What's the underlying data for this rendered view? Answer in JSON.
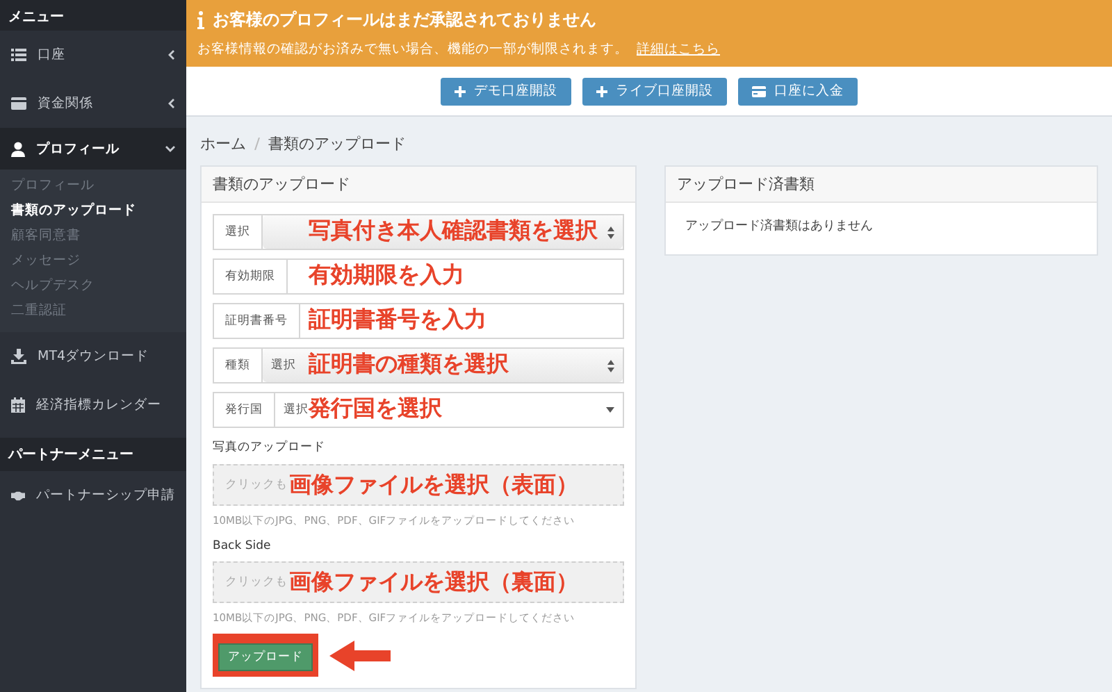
{
  "sidebar": {
    "header": "メニュー",
    "items": [
      {
        "kind": "group",
        "label": "口座",
        "expanded": false,
        "selected": false
      },
      {
        "kind": "group",
        "label": "資金関係",
        "expanded": false,
        "selected": false
      },
      {
        "kind": "group",
        "label": "プロフィール",
        "expanded": true,
        "selected": true,
        "children": [
          {
            "label": "プロフィール",
            "selected": false
          },
          {
            "label": "書類のアップロード",
            "selected": true
          },
          {
            "label": "顧客同意書",
            "selected": false
          },
          {
            "label": "メッセージ",
            "selected": false
          },
          {
            "label": "ヘルプデスク",
            "selected": false
          },
          {
            "label": "二重認証",
            "selected": false
          }
        ]
      },
      {
        "kind": "link",
        "label": "MT4ダウンロード",
        "selected": false
      },
      {
        "kind": "link",
        "label": "経済指標カレンダー",
        "selected": false
      }
    ],
    "partner_header": "パートナーメニュー",
    "partner_items": [
      {
        "label": "パートナーシップ申請"
      }
    ]
  },
  "alert": {
    "title": "お客様のプロフィールはまだ承認されておりません",
    "message": "お客様情報の確認がお済みで無い場合、機能の一部が制限されます。",
    "link": "詳細はこちら"
  },
  "action_buttons": [
    {
      "kind": "plus",
      "label": "デモ口座開設"
    },
    {
      "kind": "plus",
      "label": "ライブ口座開設"
    },
    {
      "kind": "card",
      "label": "口座に入金"
    }
  ],
  "breadcrumb": [
    "ホーム",
    "書類のアップロード"
  ],
  "upload_panel": {
    "title": "書類のアップロード",
    "fields": [
      {
        "kind": "select",
        "addon": "選択",
        "annotation": "写真付き本人確認書類を選択"
      },
      {
        "kind": "input",
        "addon": "有効期限",
        "annotation": "有効期限を入力"
      },
      {
        "kind": "input",
        "addon": "証明書番号",
        "annotation": "証明書番号を入力"
      },
      {
        "kind": "select",
        "addon": "種類",
        "value": "選択",
        "annotation": "証明書の種類を選択"
      },
      {
        "kind": "dropdown",
        "addon": "発行国",
        "value": "選択",
        "annotation": "発行国を選択"
      }
    ],
    "uploads": [
      {
        "label": "写真のアップロード",
        "placeholder": "クリックも",
        "annotation": "画像ファイルを選択（表面）",
        "hint": "10MB以下のJPG、PNG、PDF、GIFファイルをアップロードしてください"
      },
      {
        "label": "Back Side",
        "placeholder": "クリックも",
        "annotation": "画像ファイルを選択（裏面）",
        "hint": "10MB以下のJPG、PNG、PDF、GIFファイルをアップロードしてください"
      }
    ],
    "submit": "アップロード"
  },
  "uploaded_panel": {
    "title": "アップロード済書類",
    "empty_message": "アップロード済書類はありません"
  }
}
